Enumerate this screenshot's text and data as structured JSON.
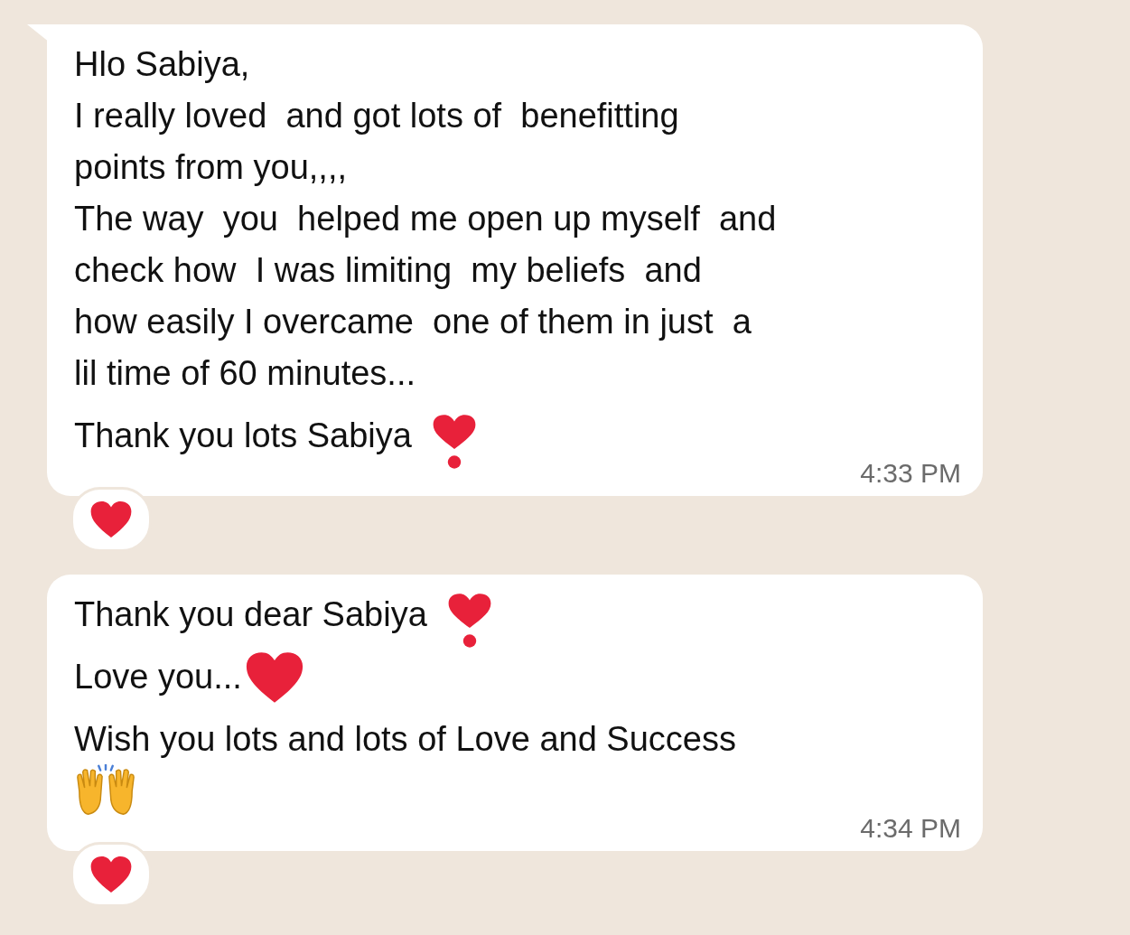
{
  "messages": [
    {
      "paragraphs": [
        {
          "lines": [
            {
              "kind": "plain",
              "text": "Hlo Sabiya,"
            },
            {
              "kind": "plain",
              "text": "I really loved  and got lots of  benefitting"
            },
            {
              "kind": "plain",
              "text": "points from you,,,,"
            },
            {
              "kind": "plain",
              "text": "The way  you  helped me open up myself  and"
            },
            {
              "kind": "plain",
              "text": "check how  I was limiting  my beliefs  and"
            },
            {
              "kind": "plain",
              "text": "how easily I overcame  one of them in just  a"
            },
            {
              "kind": "plain",
              "text": "lil time of 60 minutes..."
            }
          ]
        },
        {
          "lines": [
            {
              "kind": "exclaim",
              "text": "Thank you lots Sabiya"
            }
          ]
        }
      ],
      "time": "4:33 PM",
      "tail": true,
      "reacted": true
    },
    {
      "paragraphs": [
        {
          "lines": [
            {
              "kind": "exclaim",
              "text": "Thank you dear Sabiya"
            }
          ]
        },
        {
          "lines": [
            {
              "kind": "heart",
              "text": "Love you..."
            }
          ]
        },
        {
          "lines": [
            {
              "kind": "plain",
              "text": "Wish you lots and lots of Love and Success"
            },
            {
              "kind": "hands"
            }
          ]
        }
      ],
      "time": "4:34 PM",
      "tail": false,
      "reacted": true
    }
  ]
}
